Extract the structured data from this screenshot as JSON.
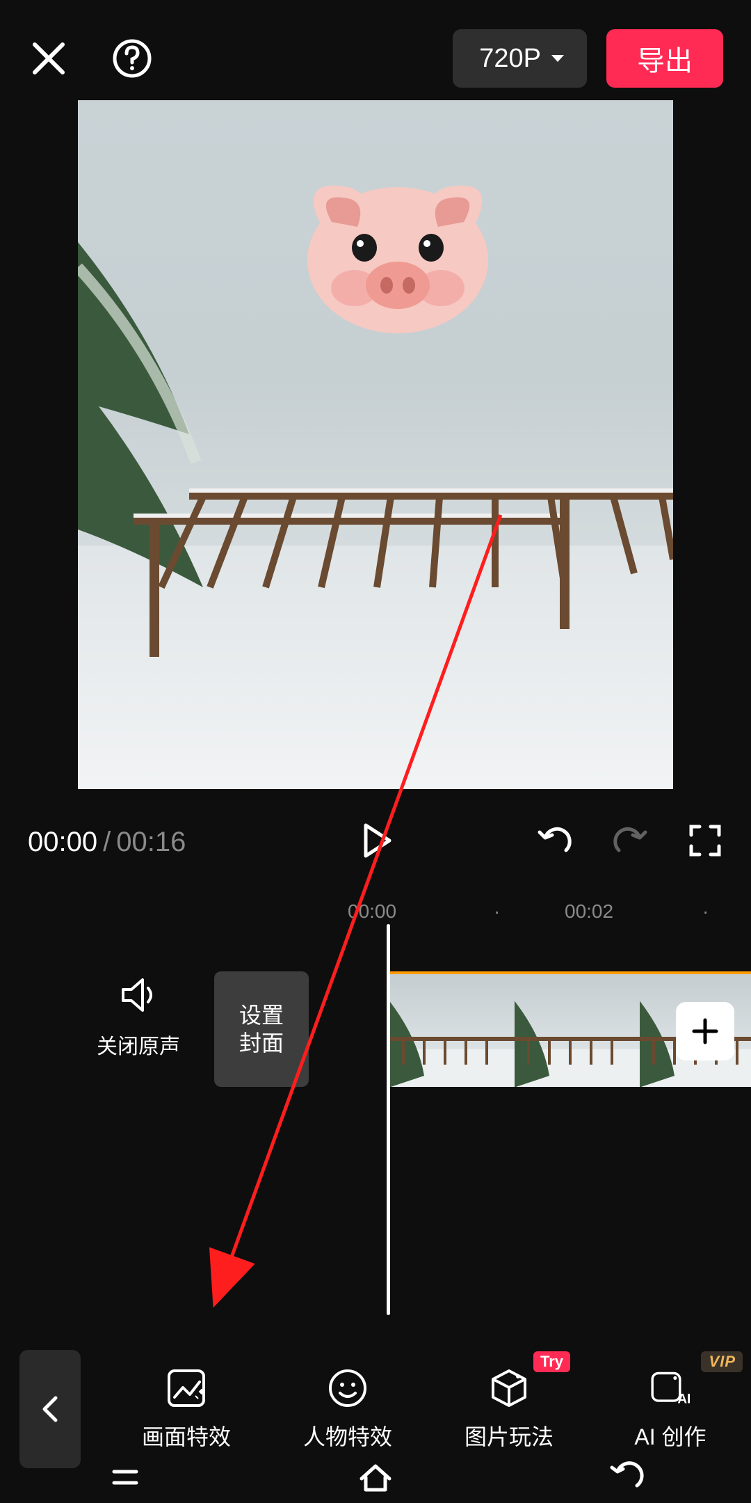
{
  "header": {
    "resolution_label": "720P",
    "export_label": "导出"
  },
  "playback": {
    "current_time": "00:00",
    "total_time": "00:16"
  },
  "ruler": {
    "t0": "00:00",
    "t1": "00:02"
  },
  "audio": {
    "mute_label": "关闭原声"
  },
  "cover": {
    "line1": "设置",
    "line2": "封面"
  },
  "toolbar": {
    "items": [
      {
        "label": "画面特效",
        "badge": null
      },
      {
        "label": "人物特效",
        "badge": null
      },
      {
        "label": "图片玩法",
        "badge": "Try"
      },
      {
        "label": "AI 创作",
        "badge": "VIP"
      }
    ]
  },
  "colors": {
    "accent": "#ff2b54",
    "clip_highlight": "#ff9a00"
  }
}
